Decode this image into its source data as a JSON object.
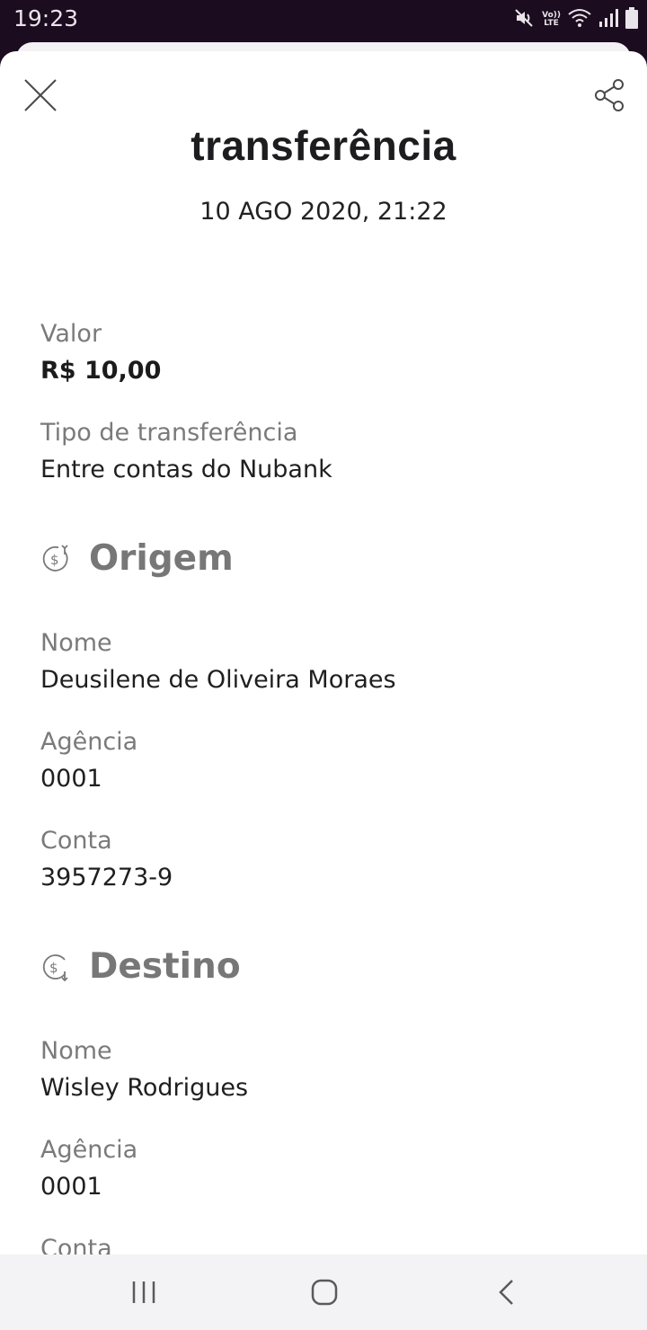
{
  "status_bar": {
    "time": "19:23",
    "network_label_top": "Vo))",
    "network_label_bottom": "LTE",
    "icons": [
      "mute-icon",
      "volte-icon",
      "wifi-icon",
      "signal-icon",
      "battery-icon"
    ]
  },
  "header": {
    "close_icon": "close-icon",
    "share_icon": "share-icon",
    "title": "transferência",
    "datetime": "10 AGO 2020, 21:22"
  },
  "transfer": {
    "value_label": "Valor",
    "value": "R$ 10,00",
    "type_label": "Tipo de transferência",
    "type": "Entre contas do Nubank"
  },
  "origin": {
    "icon": "money-out-icon",
    "title": "Origem",
    "name_label": "Nome",
    "name": "Deusilene de Oliveira Moraes",
    "agency_label": "Agência",
    "agency": "0001",
    "account_label": "Conta",
    "account": "3957273-9"
  },
  "destination": {
    "icon": "money-in-icon",
    "title": "Destino",
    "name_label": "Nome",
    "name": "Wisley Rodrigues",
    "agency_label": "Agência",
    "agency": "0001",
    "account_label": "Conta"
  },
  "nav_bar": {
    "buttons": [
      "recents-icon",
      "home-icon",
      "back-icon"
    ]
  },
  "colors": {
    "status_bar_bg": "#1c0c1f",
    "label_gray": "#7a7a7a",
    "section_gray": "#777777",
    "nav_bg": "#f3f2f4"
  }
}
